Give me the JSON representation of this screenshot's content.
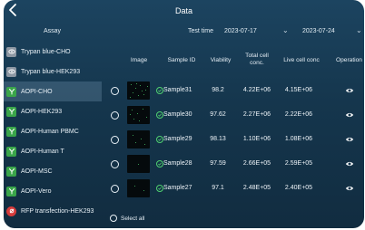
{
  "header": {
    "title": "Data"
  },
  "filters": {
    "assay_label": "Assay",
    "test_time_label": "Test time",
    "start_date": "2023-07-17",
    "end_date": "2023-07-24"
  },
  "sidebar": {
    "items": [
      {
        "label": "Trypan blue-CHO",
        "icon": "eye-icon",
        "color": "#8d97a3"
      },
      {
        "label": "Trypan blue-HEK293",
        "icon": "eye-icon",
        "color": "#8d97a3"
      },
      {
        "label": "AOPI-CHO",
        "icon": "fluorescence-icon",
        "color": "#3aa54a",
        "active": true
      },
      {
        "label": "AOPI-HEK293",
        "icon": "fluorescence-icon",
        "color": "#3aa54a"
      },
      {
        "label": "AOPI-Human PBMC",
        "icon": "fluorescence-icon",
        "color": "#3aa54a"
      },
      {
        "label": "AOPI-Human T",
        "icon": "fluorescence-icon",
        "color": "#3aa54a"
      },
      {
        "label": "AOPI-MSC",
        "icon": "fluorescence-icon",
        "color": "#3aa54a"
      },
      {
        "label": "AOPI-Vero",
        "icon": "fluorescence-icon",
        "color": "#3aa54a"
      },
      {
        "label": "RFP transfection-HEK293",
        "icon": "rfp-icon",
        "color": "#d63b3b"
      }
    ]
  },
  "table": {
    "columns": {
      "image": "Image",
      "sample_id": "Sample ID",
      "viability": "Viability",
      "total_line1": "Total cell",
      "total_line2": "conc.",
      "live": "Live cell conc",
      "operation": "Operation"
    },
    "rows": [
      {
        "sample_id": "Sample31",
        "viability": "98.2",
        "total": "4.22E+06",
        "live": "4.15E+06"
      },
      {
        "sample_id": "Sample30",
        "viability": "97.62",
        "total": "2.27E+06",
        "live": "2.22E+06"
      },
      {
        "sample_id": "Sample29",
        "viability": "98.13",
        "total": "1.10E+06",
        "live": "1.08E+06"
      },
      {
        "sample_id": "Sample28",
        "viability": "97.59",
        "total": "2.66E+05",
        "live": "2.59E+05"
      },
      {
        "sample_id": "Sample27",
        "viability": "97.1",
        "total": "2.48E+05",
        "live": "2.40E+05"
      }
    ],
    "select_all": "Select all"
  },
  "colors": {
    "accent_green": "#3aa54a",
    "background": "#15364d"
  }
}
